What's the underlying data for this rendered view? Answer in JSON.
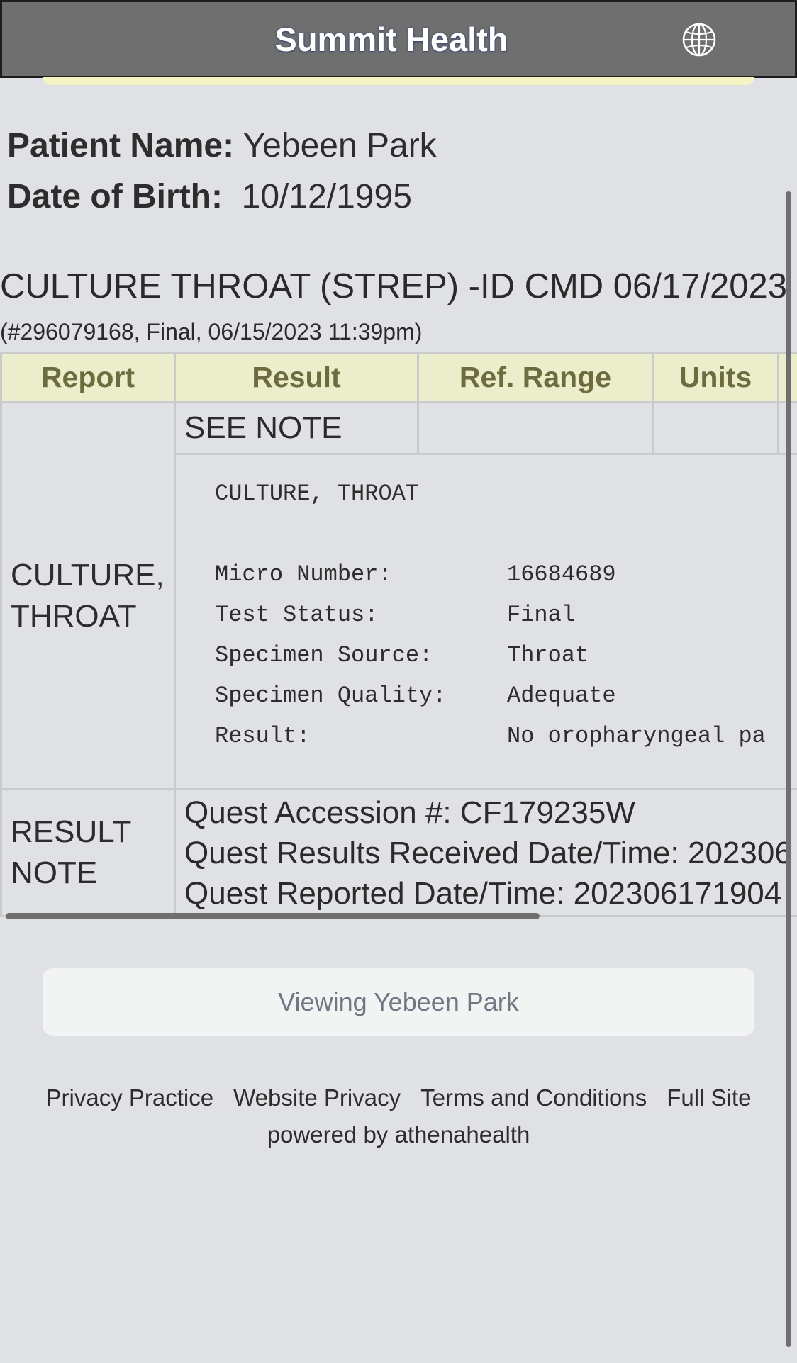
{
  "header": {
    "title": "Summit Health",
    "icon": "globe-icon"
  },
  "patient": {
    "name_label": "Patient Name:",
    "name_value": "Yebeen Park",
    "dob_label": "Date of Birth:",
    "dob_value": "10/12/1995"
  },
  "test": {
    "title": "CULTURE THROAT (STREP) -ID CMD 06/17/2023",
    "subtitle": "(#296079168, Final, 06/15/2023 11:39pm)"
  },
  "table": {
    "headers": {
      "report": "Report",
      "result": "Result",
      "ref_range": "Ref. Range",
      "units": "Units"
    },
    "row1": {
      "report_line1": "CULTURE,",
      "report_line2": "THROAT",
      "result": "SEE NOTE",
      "detail_heading": "CULTURE, THROAT",
      "details": [
        {
          "label": "Micro Number:",
          "value": "16684689"
        },
        {
          "label": "Test Status:",
          "value": "Final"
        },
        {
          "label": "Specimen Source:",
          "value": "Throat"
        },
        {
          "label": "Specimen Quality:",
          "value": "Adequate"
        },
        {
          "label": "Result:",
          "value": "No oropharyngeal pa"
        }
      ]
    },
    "row2": {
      "report_line1": "RESULT",
      "report_line2": "NOTE",
      "note_lines": [
        "Quest Accession #: CF179235W",
        "Quest Results Received Date/Time: 202306",
        "Quest Reported Date/Time: 202306171904"
      ]
    }
  },
  "viewing_button": "Viewing Yebeen Park",
  "footer": {
    "links": [
      "Privacy Practice",
      "Website Privacy",
      "Terms and Conditions",
      "Full Site"
    ],
    "powered_by": "powered by athenahealth"
  }
}
